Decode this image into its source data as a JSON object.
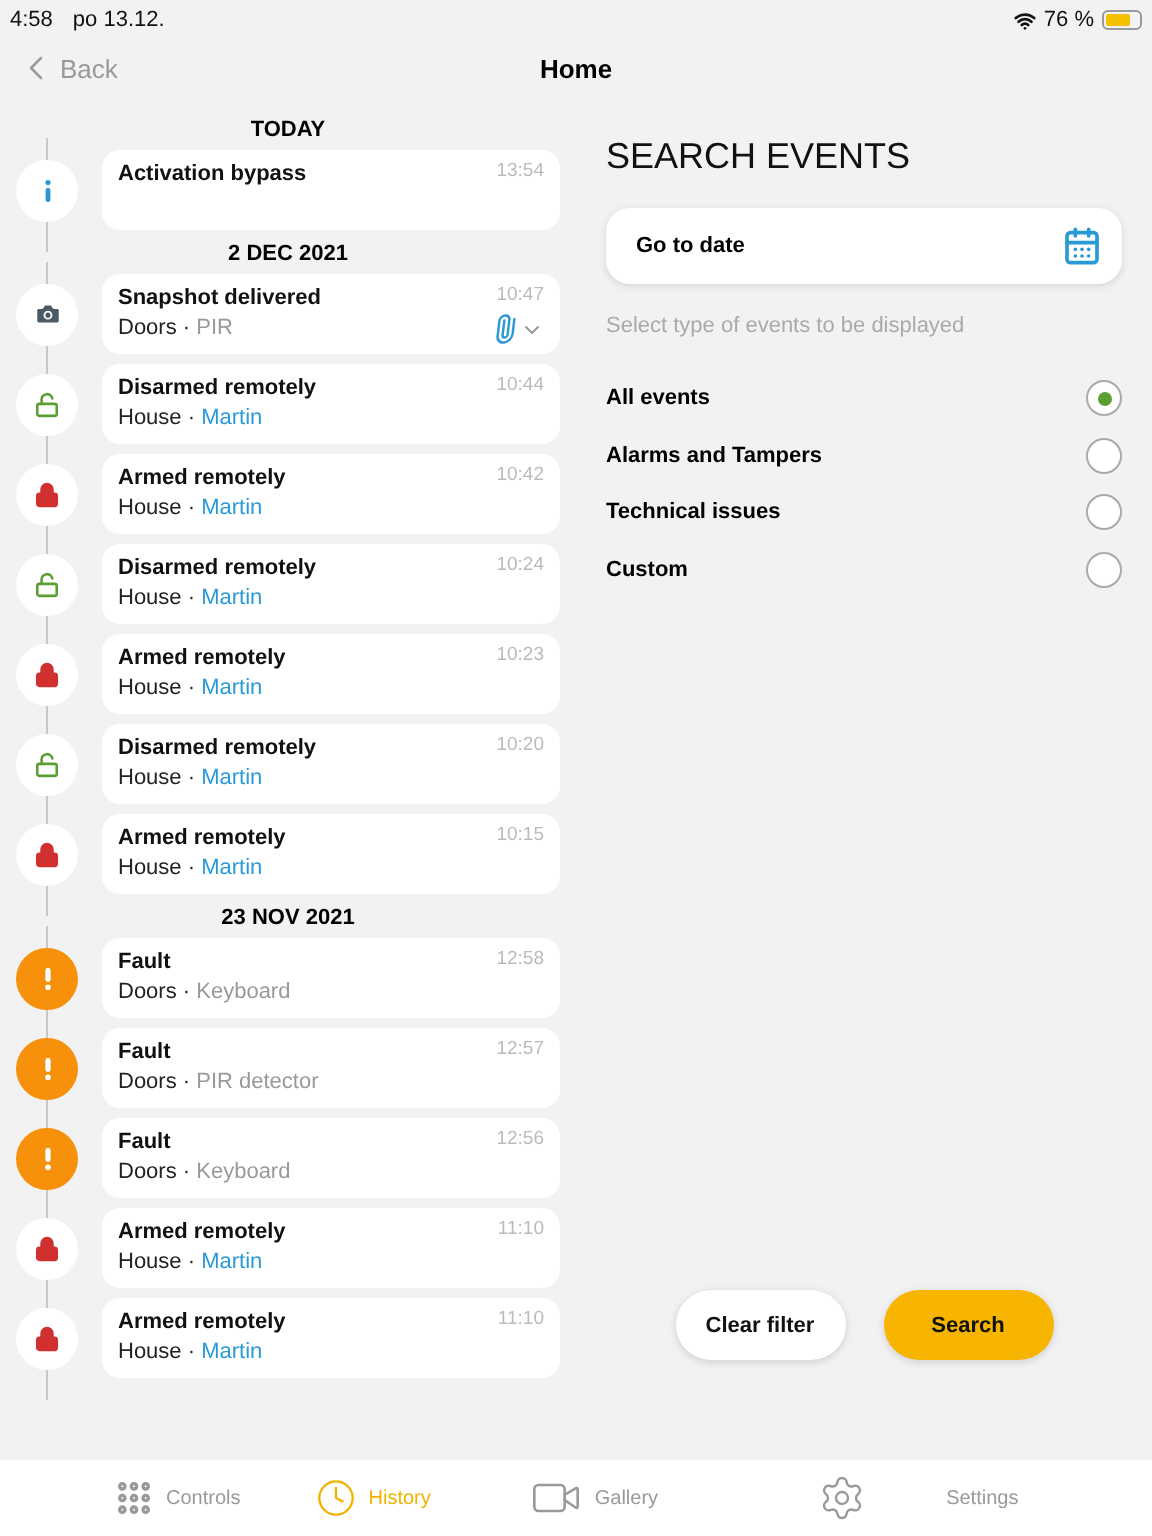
{
  "status_bar": {
    "time": "4:58",
    "date": "po 13.12.",
    "battery_text": "76 %"
  },
  "nav": {
    "back": "Back",
    "title": "Home"
  },
  "history": [
    {
      "date": "TODAY",
      "events": [
        {
          "kind": "info",
          "title": "Activation bypass",
          "time": "13:54"
        }
      ]
    },
    {
      "date": "2 DEC 2021",
      "events": [
        {
          "kind": "camera",
          "title": "Snapshot delivered",
          "time": "10:47",
          "location": "Doors ·",
          "source": {
            "text": "PIR",
            "color": "#999999"
          },
          "attachment": true
        },
        {
          "kind": "disarmed",
          "title": "Disarmed remotely",
          "time": "10:44",
          "location": "House ·",
          "source": {
            "text": "Martin",
            "color": "#2a9ad6"
          }
        },
        {
          "kind": "armed",
          "title": "Armed remotely",
          "time": "10:42",
          "location": "House ·",
          "source": {
            "text": "Martin",
            "color": "#2a9ad6"
          }
        },
        {
          "kind": "disarmed",
          "title": "Disarmed remotely",
          "time": "10:24",
          "location": "House ·",
          "source": {
            "text": "Martin",
            "color": "#2a9ad6"
          }
        },
        {
          "kind": "armed",
          "title": "Armed remotely",
          "time": "10:23",
          "location": "House ·",
          "source": {
            "text": "Martin",
            "color": "#2a9ad6"
          }
        },
        {
          "kind": "disarmed",
          "title": "Disarmed remotely",
          "time": "10:20",
          "location": "House ·",
          "source": {
            "text": "Martin",
            "color": "#2a9ad6"
          }
        },
        {
          "kind": "armed",
          "title": "Armed remotely",
          "time": "10:15",
          "location": "House ·",
          "source": {
            "text": "Martin",
            "color": "#2a9ad6"
          }
        }
      ]
    },
    {
      "date": "23 NOV 2021",
      "events": [
        {
          "kind": "fault",
          "title": "Fault",
          "time": "12:58",
          "location": "Doors ·",
          "source": {
            "text": "Keyboard",
            "color": "#999999"
          }
        },
        {
          "kind": "fault",
          "title": "Fault",
          "time": "12:57",
          "location": "Doors ·",
          "source": {
            "text": "PIR detector",
            "color": "#999999"
          }
        },
        {
          "kind": "fault",
          "title": "Fault",
          "time": "12:56",
          "location": "Doors ·",
          "source": {
            "text": "Keyboard",
            "color": "#999999"
          }
        },
        {
          "kind": "armed",
          "title": "Armed remotely",
          "time": "11:10",
          "location": "House ·",
          "source": {
            "text": "Martin",
            "color": "#2a9ad6"
          }
        },
        {
          "kind": "armed",
          "title": "Armed remotely",
          "time": "11:10",
          "location": "House ·",
          "source": {
            "text": "Martin",
            "color": "#2a9ad6"
          }
        }
      ]
    }
  ],
  "search": {
    "title": "SEARCH EVENTS",
    "date_field": "Go to date",
    "hint": "Select type of events to be displayed",
    "options": [
      {
        "label": "All events",
        "selected": true
      },
      {
        "label": "Alarms and Tampers",
        "selected": false
      },
      {
        "label": "Technical issues",
        "selected": false
      },
      {
        "label": "Custom",
        "selected": false
      }
    ],
    "clear_button": "Clear filter",
    "search_button": "Search"
  },
  "tab_bar": [
    {
      "kind": "controls",
      "label": "Controls",
      "selected": false
    },
    {
      "kind": "history",
      "label": "History",
      "selected": true
    },
    {
      "kind": "gallery",
      "label": "Gallery",
      "selected": false
    },
    {
      "kind": "settings",
      "label": "Settings",
      "selected": false
    }
  ]
}
